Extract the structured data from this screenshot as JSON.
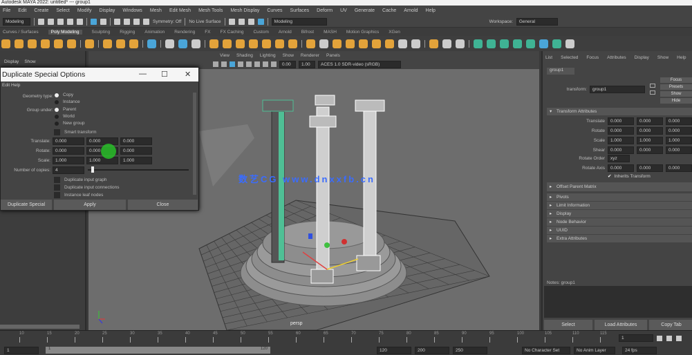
{
  "window": {
    "title": "Autodesk MAYA 2022: untitled* --- group1"
  },
  "menubar": [
    "File",
    "Edit",
    "Create",
    "Select",
    "Modify",
    "Display",
    "Windows",
    "Mesh",
    "Edit Mesh",
    "Mesh Tools",
    "Mesh Display",
    "Curves",
    "Surfaces",
    "Deform",
    "UV",
    "Generate",
    "Cache",
    "Arnold",
    "Help"
  ],
  "statusline": {
    "mode": "Modeling",
    "symmetry": "Symmetry: Off",
    "live": "No Live Surface",
    "workspace_label": "Workspace:",
    "workspace": "General"
  },
  "shelf_tabs": [
    "Curves / Surfaces",
    "Poly Modeling",
    "Sculpting",
    "Rigging",
    "Animation",
    "Rendering",
    "FX",
    "FX Caching",
    "Custom",
    "Arnold",
    "Bifrost",
    "MASH",
    "Motion Graphics",
    "XGen"
  ],
  "shelf_active": 1,
  "left_panel": {
    "items": [
      "Display",
      "Show"
    ]
  },
  "viewport": {
    "menu": [
      "View",
      "Shading",
      "Lighting",
      "Show",
      "Renderer",
      "Panels"
    ],
    "field1": "0.00",
    "field2": "1.00",
    "colorspace": "ACES 1.0 SDR-video (sRGB)",
    "camera": "persp",
    "watermark": "数艺CG www.dnxxfb.cn"
  },
  "dialog": {
    "title": "Duplicate Special Options",
    "menu": "Edit  Help",
    "geometry_type_label": "Geometry type:",
    "geometry_options": [
      "Copy",
      "Instance"
    ],
    "group_under_label": "Group under:",
    "group_options": [
      "Parent",
      "World",
      "New group"
    ],
    "smart_transform": "Smart transform",
    "translate_label": "Translate:",
    "translate": [
      "0.000",
      "0.000",
      "0.000"
    ],
    "rotate_label": "Rotate:",
    "rotate": [
      "0.000",
      "0.000",
      "0.000"
    ],
    "scale_label": "Scale:",
    "scale": [
      "1.000",
      "1.000",
      "1.000"
    ],
    "copies_label": "Number of copies:",
    "copies": "4",
    "checkboxes": [
      "Duplicate input graph",
      "Duplicate input connections",
      "Instance leaf nodes"
    ],
    "buttons": [
      "Duplicate Special",
      "Apply",
      "Close"
    ]
  },
  "attribute_editor": {
    "tabs": [
      "List",
      "Selected",
      "Focus",
      "Attributes",
      "Display",
      "Show",
      "Help"
    ],
    "node_tab": "group1",
    "node_label": "transform:",
    "node_name": "group1",
    "side_buttons": [
      "Focus",
      "Presets",
      "Show",
      "Hide"
    ],
    "transform_section": "Transform Attributes",
    "rows": [
      {
        "label": "Translate",
        "values": [
          "0.000",
          "0.000",
          "0.000"
        ]
      },
      {
        "label": "Rotate",
        "values": [
          "0.000",
          "0.000",
          "0.000"
        ]
      },
      {
        "label": "Scale",
        "values": [
          "1.000",
          "1.000",
          "1.000"
        ]
      },
      {
        "label": "Shear",
        "values": [
          "0.000",
          "0.000",
          "0.000"
        ]
      }
    ],
    "rotate_order_label": "Rotate Order",
    "rotate_order": "xyz",
    "rotate_axis_label": "Rotate Axis",
    "rotate_axis": [
      "0.000",
      "0.000",
      "0.000"
    ],
    "inherits": "Inherits Transform",
    "offset_parent": "Offset Parent Matrix",
    "sections": [
      "Pivots",
      "Limit Information",
      "Display",
      "Node Behavior",
      "UUID",
      "Extra Attributes"
    ],
    "notes_label": "Notes: group1",
    "buttons": [
      "Select",
      "Load Attributes",
      "Copy Tab"
    ]
  },
  "timeline": {
    "ticks": [
      "10",
      "15",
      "20",
      "25",
      "30",
      "35",
      "40",
      "45",
      "50",
      "55",
      "60",
      "65",
      "70",
      "75",
      "80",
      "85",
      "90",
      "95",
      "100",
      "105",
      "110",
      "115"
    ],
    "current": "1"
  },
  "rangebar": {
    "start": "1",
    "range_start": "1",
    "range_end": "120",
    "end1": "120",
    "end2": "200",
    "end3": "250",
    "char_set": "No Character Set",
    "anim_layer": "No Anim Layer",
    "fps": "24 fps"
  }
}
